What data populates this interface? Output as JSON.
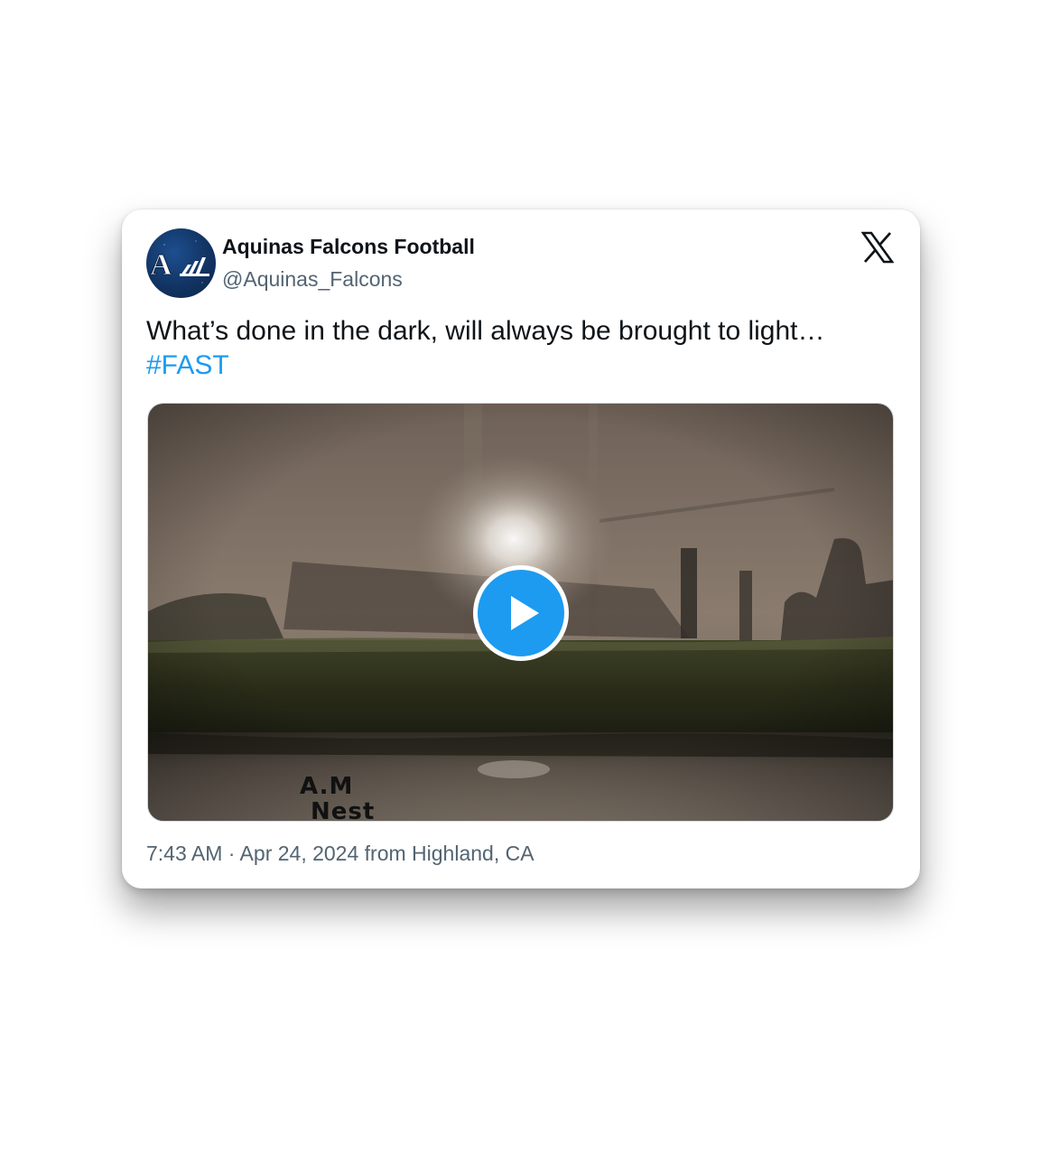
{
  "tweet": {
    "author_name": "Aquinas Falcons Football",
    "author_handle": "@Aquinas_Falcons",
    "text": "What’s done in the dark, will always be brought to light…",
    "hashtag": "#FAST",
    "timestamp": "7:43 AM · Apr 24, 2024 from Highland, CA"
  },
  "avatar": {
    "icon": "aquinas-logo",
    "letter": "A"
  },
  "media": {
    "type": "video",
    "watermark_line1": "A.M",
    "watermark_line2": "Nest"
  },
  "icons": {
    "platform": "x-logo-icon",
    "play": "play-icon"
  },
  "colors": {
    "link": "#1d9bf0",
    "text": "#0f1419",
    "secondary_text": "#536471",
    "avatar_bg": "#123463"
  }
}
